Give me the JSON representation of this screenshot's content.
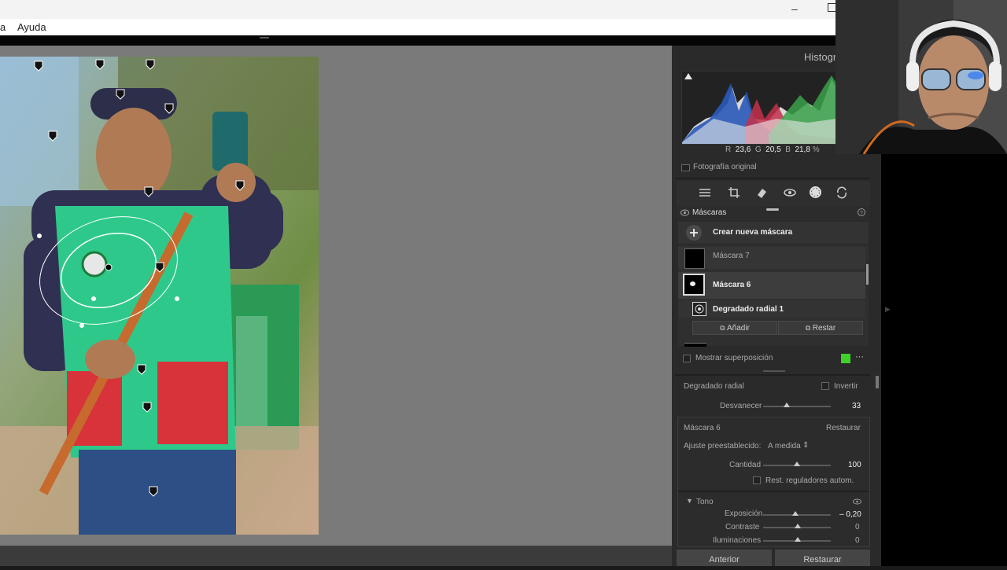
{
  "menu": {
    "item_a": "a",
    "item_ayuda": "Ayuda"
  },
  "histogram": {
    "title": "Histogr",
    "r_label": "R",
    "r_value": "23,6",
    "g_label": "G",
    "g_value": "20,5",
    "b_label": "B",
    "b_value": "21,8",
    "unit": "%"
  },
  "original_photo_label": "Fotografía original",
  "masks": {
    "title": "Máscaras",
    "create_label": "Crear nueva máscara",
    "mask7": "Máscara 7",
    "mask6": "Máscara 6",
    "radial": "Degradado radial 1",
    "add": "Añadir",
    "subtract": "Restar",
    "overlay": "Mostrar superposición"
  },
  "radial_settings": {
    "title": "Degradado radial",
    "invert": "Invertir",
    "feather_label": "Desvanecer",
    "feather_value": "33"
  },
  "mask6_settings": {
    "title": "Máscara 6",
    "reset": "Restaurar",
    "preset_label": "Ajuste preestablecido:",
    "preset_value": "A medida",
    "amount_label": "Cantidad",
    "amount_value": "100",
    "auto_reset": "Rest. reguladores autom."
  },
  "tone": {
    "title": "Tono",
    "exposure_label": "Exposición",
    "exposure_value": "– 0,20",
    "contrast_label": "Contraste",
    "contrast_value": "0",
    "highlights_label": "Iluminaciones",
    "highlights_value": "0"
  },
  "footer": {
    "previous": "Anterior",
    "reset": "Restaurar"
  },
  "colors": {
    "accent_green": "#3fd12b",
    "panel_bg": "#2a2a2a",
    "canvas_bg": "#7a7a7a"
  }
}
